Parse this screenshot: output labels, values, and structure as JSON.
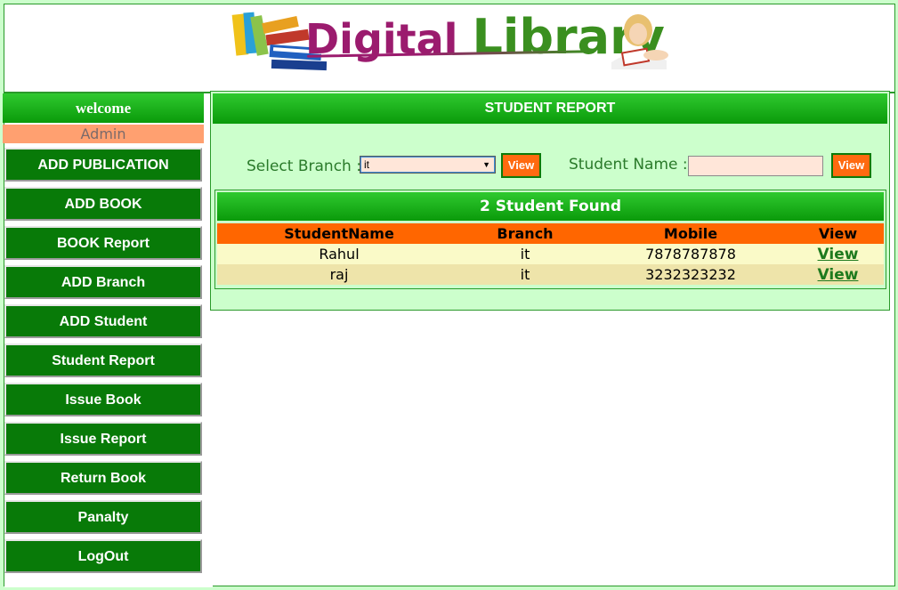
{
  "header": {
    "logo_part1": "Digital",
    "logo_part2": "Library"
  },
  "sidebar": {
    "welcome": "welcome",
    "user": "Admin",
    "items": [
      {
        "label": "ADD PUBLICATION"
      },
      {
        "label": "ADD BOOK"
      },
      {
        "label": "BOOK Report"
      },
      {
        "label": "ADD Branch"
      },
      {
        "label": "ADD Student"
      },
      {
        "label": "Student Report"
      },
      {
        "label": "Issue Book"
      },
      {
        "label": "Issue Report"
      },
      {
        "label": "Return Book"
      },
      {
        "label": "Panalty"
      },
      {
        "label": "LogOut"
      }
    ]
  },
  "main": {
    "title": "STUDENT REPORT",
    "branch_label": "Select Branch :",
    "branch_selected": "it",
    "branch_view": "View",
    "name_label": "Student Name :",
    "name_value": "",
    "name_view": "View",
    "result_title": "2 Student Found",
    "columns": [
      "StudentName",
      "Branch",
      "Mobile",
      "View"
    ],
    "rows": [
      {
        "name": "Rahul",
        "branch": "it",
        "mobile": "7878787878",
        "view": "View"
      },
      {
        "name": "raj",
        "branch": "it",
        "mobile": "3232323232",
        "view": "View"
      }
    ]
  },
  "colors": {
    "accent_green": "#0a9a0a",
    "button_orange": "#ff6a10",
    "table_header": "#ff6600",
    "panel_bg": "#ccffcc"
  }
}
